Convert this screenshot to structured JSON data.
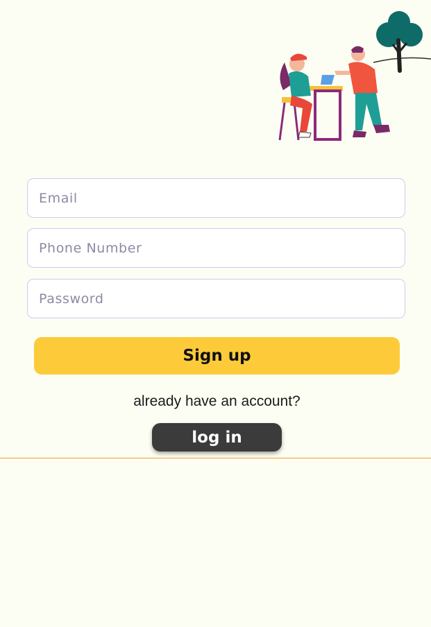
{
  "form": {
    "email_placeholder": "Email",
    "phone_placeholder": "Phone Number",
    "password_placeholder": "Password",
    "signup_label": "Sign up"
  },
  "login": {
    "prompt": "already have an account?",
    "button_label": "log in"
  },
  "colors": {
    "background": "#fdfef3",
    "field_border": "#c7cdf3",
    "signup_button": "#fdcb3a",
    "login_button": "#3b3b3b",
    "divider": "#f2a21c"
  },
  "illustration": {
    "icon": "people-at-table-illustration"
  }
}
